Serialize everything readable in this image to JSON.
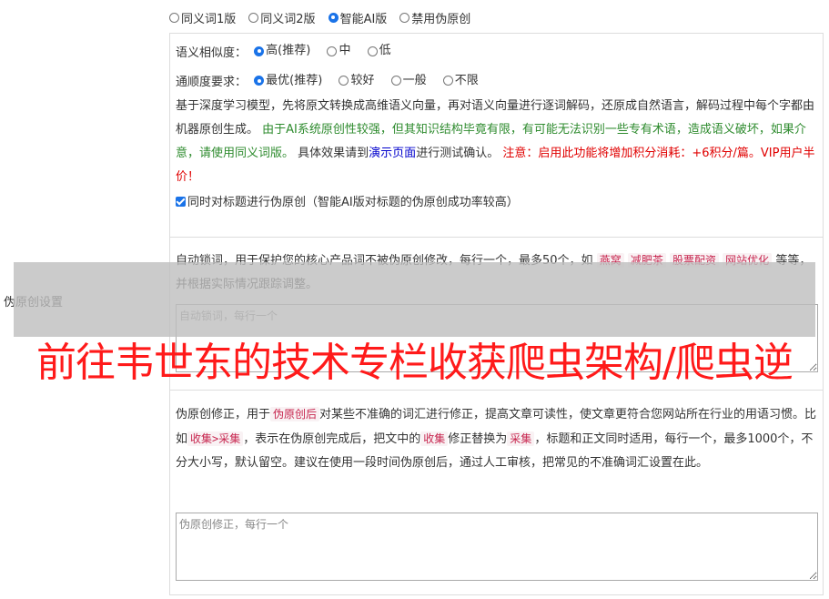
{
  "version_options": [
    {
      "label": "同义词1版",
      "checked": false
    },
    {
      "label": "同义词2版",
      "checked": false
    },
    {
      "label": "智能AI版",
      "checked": true
    },
    {
      "label": "禁用伪原创",
      "checked": false
    }
  ],
  "similarity": {
    "label": "语义相似度：",
    "options": [
      {
        "label": "高(推荐)",
        "checked": true
      },
      {
        "label": "中",
        "checked": false
      },
      {
        "label": "低",
        "checked": false
      }
    ]
  },
  "fluency": {
    "label": "通顺度要求：",
    "options": [
      {
        "label": "最优(推荐)",
        "checked": true
      },
      {
        "label": "较好",
        "checked": false
      },
      {
        "label": "一般",
        "checked": false
      },
      {
        "label": "不限",
        "checked": false
      }
    ]
  },
  "ai_desc": {
    "part1": "基于深度学习模型，先将原文转换成高维语义向量，再对语义向量进行逐词解码，还原成自然语言，解码过程中每个字都由机器原创生成。",
    "part2_green": "由于AI系统原创性较强，但其知识结构毕竟有限，有可能无法识别一些专有术语，造成语义破坏，如果介意，请使用同义词版。",
    "part3": "具体效果请到",
    "link": "演示页面",
    "part4": "进行测试确认。",
    "part5_red": "注意：启用此功能将增加积分消耗：+6积分/篇。VIP用户半价！"
  },
  "title_checkbox": {
    "label": "同时对标题进行伪原创（智能AI版对标题的伪原创成功率较高）",
    "checked": true
  },
  "lock": {
    "text1": "自动锁词，用于保护您的核心产品词不被伪原创修改，每行一个，最多50个，如",
    "tags": [
      "燕窝",
      "减肥茶",
      "股票配资",
      "网站优化"
    ],
    "text2": "等等，并根据实际情况跟踪调整。",
    "placeholder": "自动锁词，每行一个"
  },
  "section_label": "伪原创设置",
  "fix": {
    "text1": "伪原创修正，用于",
    "tag1": "伪原创后",
    "text2": "对某些不准确的词汇进行修正，提高文章可读性，使文章更符合您网站所在行业的用语习惯。比如",
    "tag2": "收集>采集",
    "text3": "，表示在伪原创完成后，把文中的",
    "tag3": "收集",
    "text4": "修正替换为",
    "tag4": "采集",
    "text5": "，标题和正文同时适用，每行一个，最多1000个，不分大小写，默认留空。建议在使用一段时间伪原创后，通过人工审核，把常见的不准确词汇设置在此。",
    "placeholder": "伪原创修正，每行一个"
  },
  "watermark": "前往韦世东的技术专栏收获爬虫架构/爬虫逆"
}
